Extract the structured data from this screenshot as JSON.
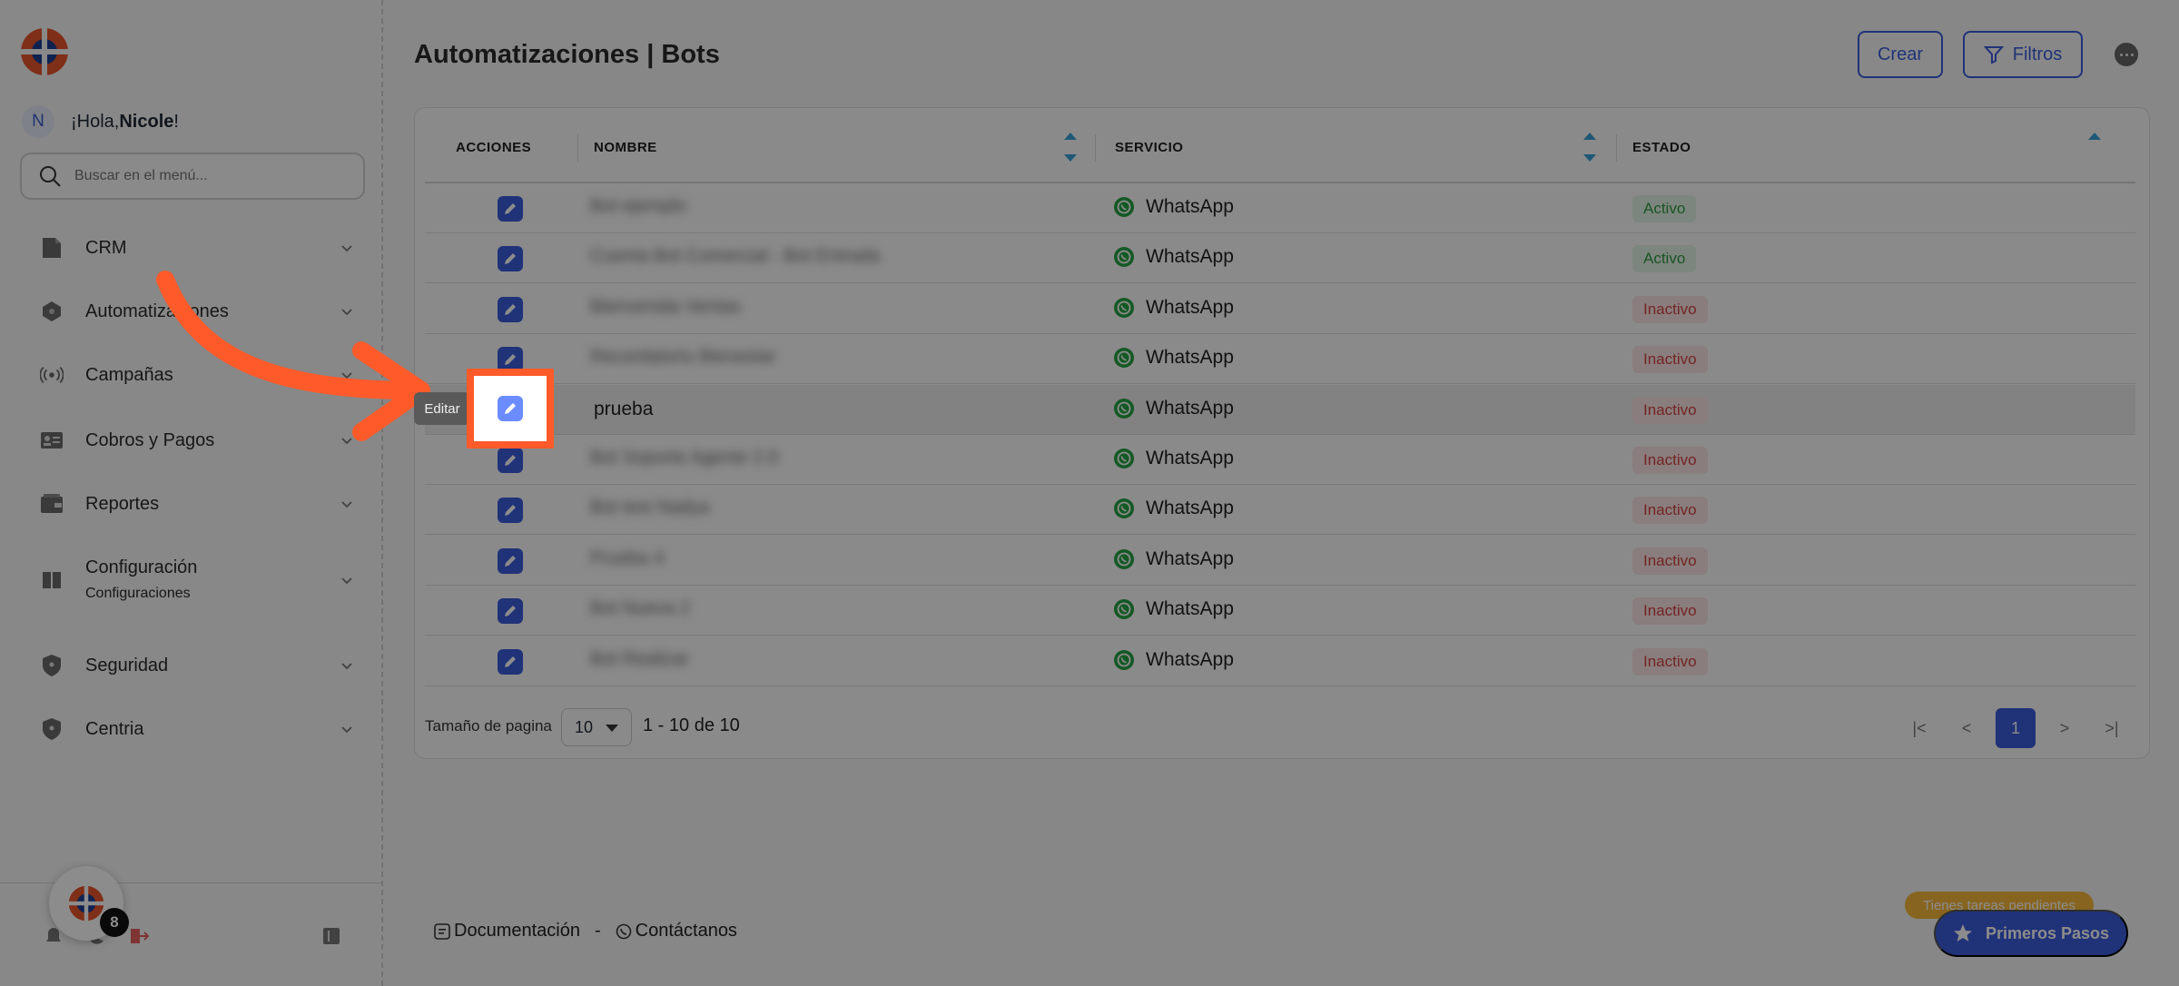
{
  "sidebar": {
    "greeting_prefix": "¡Hola, ",
    "user_name": "Nicole",
    "greeting_suffix": "!",
    "avatar_letter": "N",
    "search_placeholder": "Buscar en el menú...",
    "items": [
      {
        "label": "CRM",
        "icon": "document-icon"
      },
      {
        "label": "Automatizaciones",
        "icon": "hexagon-icon"
      },
      {
        "label": "Campañas",
        "icon": "broadcast-icon"
      },
      {
        "label": "Cobros y Pagos",
        "icon": "id-card-icon"
      },
      {
        "label": "Reportes",
        "icon": "wallet-icon"
      },
      {
        "label": "Configuración",
        "sub": "Configuraciones",
        "icon": "book-icon"
      },
      {
        "label": "Seguridad",
        "icon": "shield-icon"
      },
      {
        "label": "Centria",
        "icon": "shield-icon"
      }
    ],
    "notification_count": "8"
  },
  "header": {
    "title": "Automatizaciones | Bots",
    "create_label": "Crear",
    "filters_label": "Filtros"
  },
  "table": {
    "columns": [
      "ACCIONES",
      "NOMBRE",
      "SERVICIO",
      "ESTADO"
    ],
    "rows": [
      {
        "name": "Bot ejemplo",
        "service": "WhatsApp",
        "status": "Activo"
      },
      {
        "name": "Cuenta Bot Comercial - Bot Entrada",
        "service": "WhatsApp",
        "status": "Activo"
      },
      {
        "name": "Bienvenida Ventas",
        "service": "WhatsApp",
        "status": "Inactivo"
      },
      {
        "name": "Recordatorio Bienestar",
        "service": "WhatsApp",
        "status": "Inactivo"
      },
      {
        "name": "prueba",
        "service": "WhatsApp",
        "status": "Inactivo"
      },
      {
        "name": "Bot Soporte Agente 2.0",
        "service": "WhatsApp",
        "status": "Inactivo"
      },
      {
        "name": "Bot test Nadya",
        "service": "WhatsApp",
        "status": "Inactivo"
      },
      {
        "name": "Prueba 4",
        "service": "WhatsApp",
        "status": "Inactivo"
      },
      {
        "name": "Bot Nueva 2",
        "service": "WhatsApp",
        "status": "Inactivo"
      },
      {
        "name": "Bot Realizar",
        "service": "WhatsApp",
        "status": "Inactivo"
      }
    ],
    "page_size_label": "Tamaño de pagina",
    "page_size": "10",
    "range": "1 - 10 de 10",
    "current_page": "1"
  },
  "tooltip": "Editar",
  "footer": {
    "docs": "Documentación",
    "separator": "-",
    "contact": "Contáctanos"
  },
  "onboarding": {
    "pending": "Tienes tareas pendientes",
    "button": "Primeros Pasos"
  },
  "colors": {
    "accent": "#3b5bdb",
    "highlight": "#ff5a2a",
    "active_text": "#2e9a44",
    "inactive_text": "#d24343",
    "whatsapp": "#25a244"
  }
}
